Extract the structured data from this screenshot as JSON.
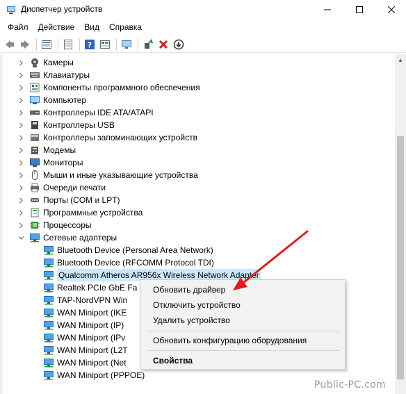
{
  "window": {
    "title": "Диспетчер устройств",
    "controls": {
      "minimize": "–",
      "maximize": "☐",
      "close": "✕"
    }
  },
  "menu": [
    {
      "label": "Файл"
    },
    {
      "label": "Действие"
    },
    {
      "label": "Вид"
    },
    {
      "label": "Справка"
    }
  ],
  "toolbar": {
    "icons": [
      "back-arrow-icon",
      "forward-arrow-icon",
      "properties-icon",
      "list-icon",
      "help-icon",
      "view-icon",
      "monitor-icon",
      "add-driver-icon",
      "remove-icon",
      "download-icon"
    ]
  },
  "tree": {
    "categories": [
      {
        "label": "Камеры",
        "icon": "camera-icon",
        "expanded": false
      },
      {
        "label": "Клавиатуры",
        "icon": "keyboard-icon",
        "expanded": false
      },
      {
        "label": "Компоненты программного обеспечения",
        "icon": "software-component-icon",
        "expanded": false
      },
      {
        "label": "Компьютер",
        "icon": "computer-icon",
        "expanded": false
      },
      {
        "label": "Контроллеры IDE ATA/ATAPI",
        "icon": "ide-controller-icon",
        "expanded": false
      },
      {
        "label": "Контроллеры USB",
        "icon": "usb-controller-icon",
        "expanded": false
      },
      {
        "label": "Контроллеры запоминающих устройств",
        "icon": "storage-controller-icon",
        "expanded": false
      },
      {
        "label": "Модемы",
        "icon": "modem-icon",
        "expanded": false
      },
      {
        "label": "Мониторы",
        "icon": "monitor-icon",
        "expanded": false
      },
      {
        "label": "Мыши и иные указывающие устройства",
        "icon": "mouse-icon",
        "expanded": false
      },
      {
        "label": "Очереди печати",
        "icon": "printer-icon",
        "expanded": false
      },
      {
        "label": "Порты (COM и LPT)",
        "icon": "port-icon",
        "expanded": false
      },
      {
        "label": "Программные устройства",
        "icon": "software-device-icon",
        "expanded": false
      },
      {
        "label": "Процессоры",
        "icon": "processor-icon",
        "expanded": false
      },
      {
        "label": "Сетевые адаптеры",
        "icon": "network-adapter-icon",
        "expanded": true
      }
    ],
    "network_children": [
      {
        "label": "Bluetooth Device (Personal Area Network)"
      },
      {
        "label": "Bluetooth Device (RFCOMM Protocol TDI)"
      },
      {
        "label": "Qualcomm Atheros AR956x Wireless Network Adapter",
        "selected": true
      },
      {
        "label": "Realtek PCIe GbE Fa"
      },
      {
        "label": "TAP-NordVPN Win"
      },
      {
        "label": "WAN Miniport (IKE"
      },
      {
        "label": "WAN Miniport (IP)"
      },
      {
        "label": "WAN Miniport (IPv"
      },
      {
        "label": "WAN Miniport (L2T"
      },
      {
        "label": "WAN Miniport (Net"
      },
      {
        "label": "WAN Miniport (PPPOE)"
      }
    ]
  },
  "context_menu": {
    "update_driver": "Обновить драйвер",
    "disable_device": "Отключить устройство",
    "uninstall_device": "Удалить устройство",
    "scan_hardware": "Обновить конфигурацию оборудования",
    "properties": "Свойства"
  },
  "watermark": "Public-PC.com",
  "colors": {
    "selection": "#cce8ff",
    "arrow": "#e11b22",
    "close_x": "#d21f1f",
    "add_green": "#2a9a3a"
  }
}
